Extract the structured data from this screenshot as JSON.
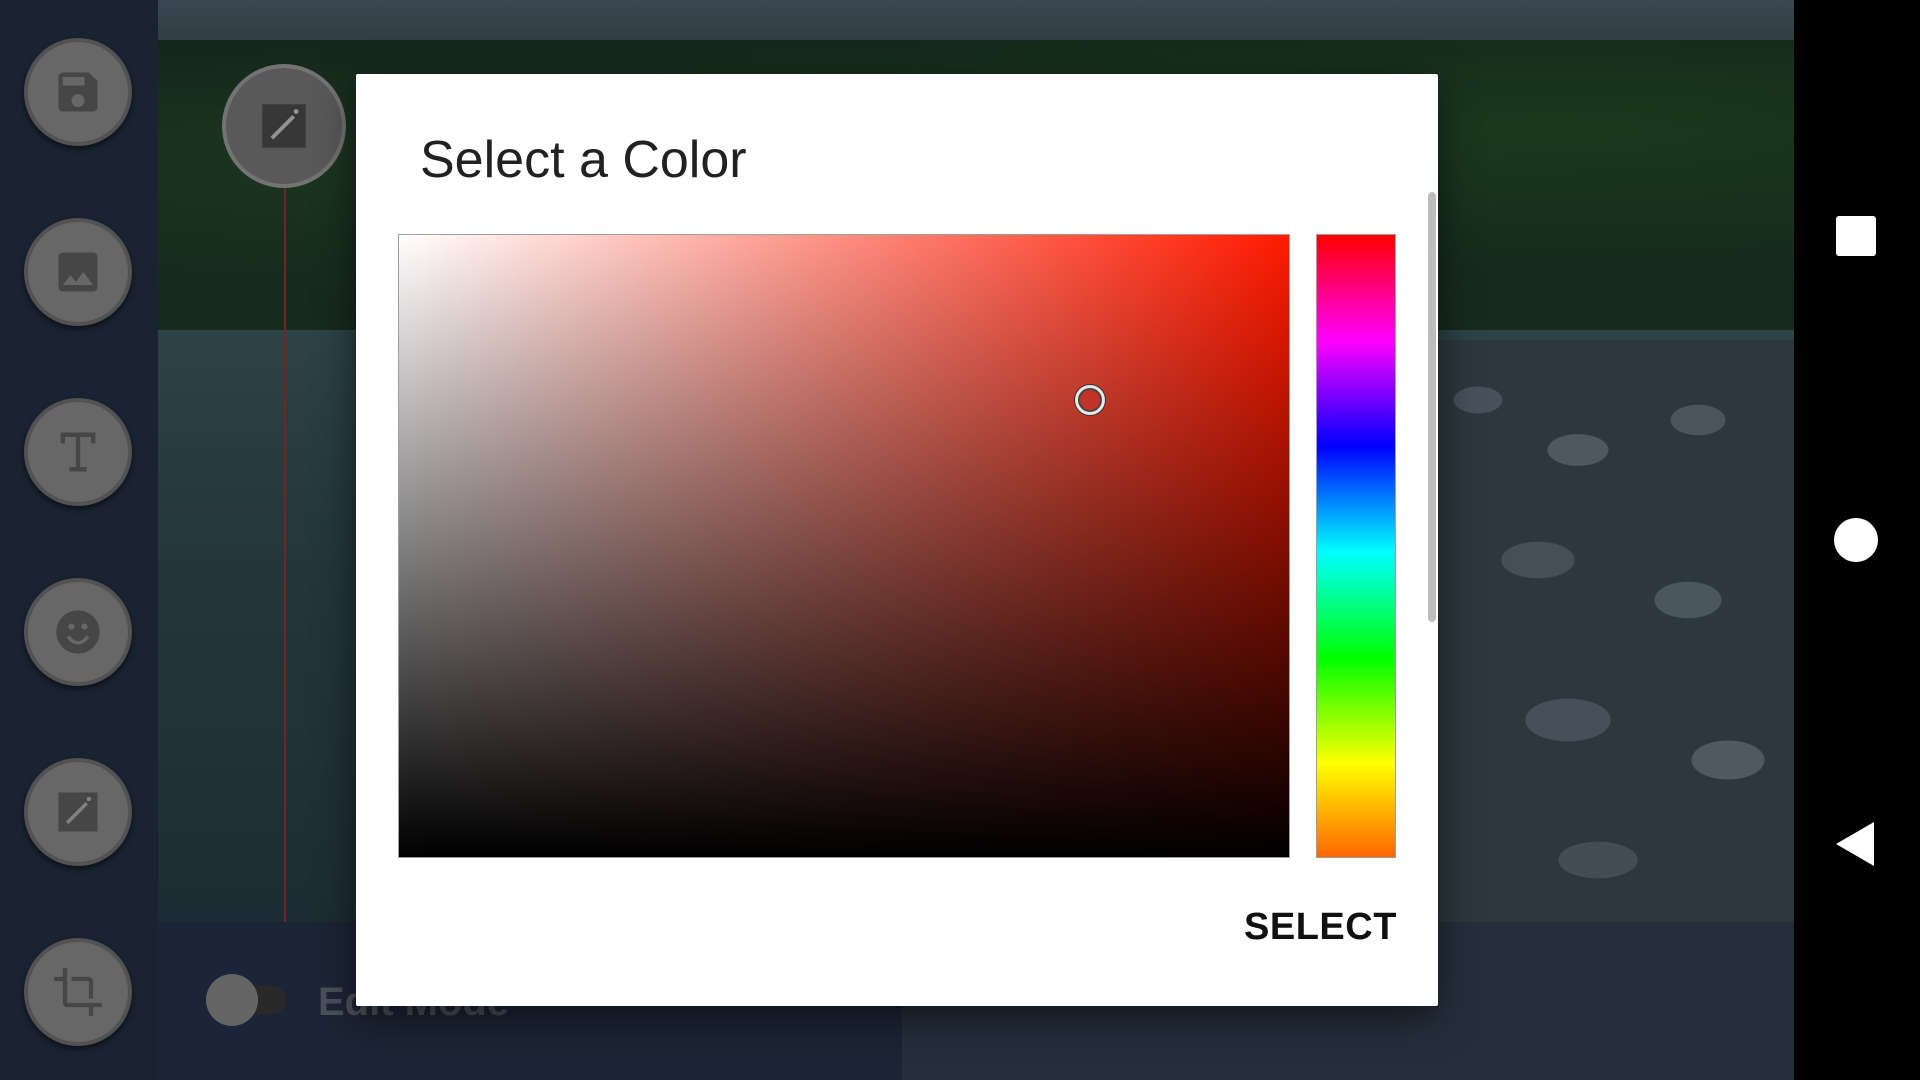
{
  "dialog": {
    "title": "Select a Color",
    "select_label": "SELECT",
    "hue_color": "#ff1a00",
    "selected_color": "#c4332a"
  },
  "editor": {
    "edit_mode_label": "Edit Mode",
    "edit_mode_on": false,
    "tools": [
      "save-icon",
      "image-icon",
      "text-icon",
      "emoji-icon",
      "magic-wand-icon",
      "crop-icon"
    ]
  },
  "navbar": {
    "buttons": [
      "recents-icon",
      "home-icon",
      "back-icon"
    ]
  }
}
